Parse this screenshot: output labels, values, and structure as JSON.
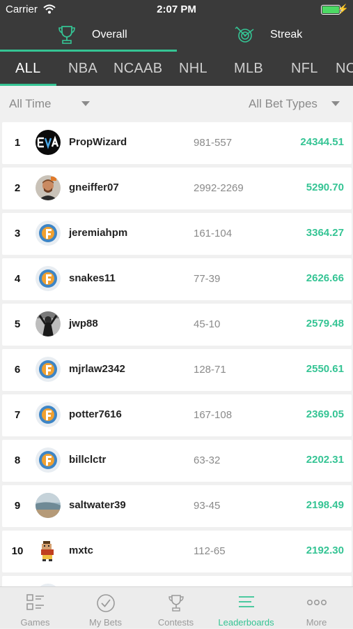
{
  "status_bar": {
    "carrier": "Carrier",
    "time": "2:07 PM"
  },
  "mode_tabs": [
    {
      "label": "Overall",
      "icon": "trophy-icon",
      "active": true
    },
    {
      "label": "Streak",
      "icon": "target-icon",
      "active": false
    }
  ],
  "sport_tabs": [
    "ALL",
    "NBA",
    "NCAAB",
    "NHL",
    "MLB",
    "NFL",
    "NC"
  ],
  "filters": {
    "time_range": "All Time",
    "bet_types": "All Bet Types"
  },
  "leaderboard": [
    {
      "rank": "1",
      "name": "PropWizard",
      "record": "981-557",
      "score": "24344.51",
      "avatar": "eva-logo"
    },
    {
      "rank": "2",
      "name": "gneiffer07",
      "record": "2992-2269",
      "score": "5290.70",
      "avatar": "photo-person"
    },
    {
      "rank": "3",
      "name": "jeremiahpm",
      "record": "161-104",
      "score": "3364.27",
      "avatar": "default-gear"
    },
    {
      "rank": "4",
      "name": "snakes11",
      "record": "77-39",
      "score": "2626.66",
      "avatar": "default-gear"
    },
    {
      "rank": "5",
      "name": "jwp88",
      "record": "45-10",
      "score": "2579.48",
      "avatar": "photo-bw"
    },
    {
      "rank": "6",
      "name": "mjrlaw2342",
      "record": "128-71",
      "score": "2550.61",
      "avatar": "default-gear"
    },
    {
      "rank": "7",
      "name": "potter7616",
      "record": "167-108",
      "score": "2369.05",
      "avatar": "default-gear"
    },
    {
      "rank": "8",
      "name": "billclctr",
      "record": "63-32",
      "score": "2202.31",
      "avatar": "default-gear"
    },
    {
      "rank": "9",
      "name": "saltwater39",
      "record": "93-45",
      "score": "2198.49",
      "avatar": "photo-beach"
    },
    {
      "rank": "10",
      "name": "mxtc",
      "record": "112-65",
      "score": "2192.30",
      "avatar": "pixel-character"
    }
  ],
  "bottom_tabs": [
    {
      "label": "Games",
      "icon": "games-icon",
      "active": false
    },
    {
      "label": "My Bets",
      "icon": "checkmark-circle-icon",
      "active": false
    },
    {
      "label": "Contests",
      "icon": "trophy-icon",
      "active": false
    },
    {
      "label": "Leaderboards",
      "icon": "leaderboard-lines-icon",
      "active": true
    },
    {
      "label": "More",
      "icon": "more-dots-icon",
      "active": false
    }
  ],
  "colors": {
    "accent": "#35c494",
    "header_bg": "#3a3a3a",
    "page_bg": "#f0f0f0"
  }
}
